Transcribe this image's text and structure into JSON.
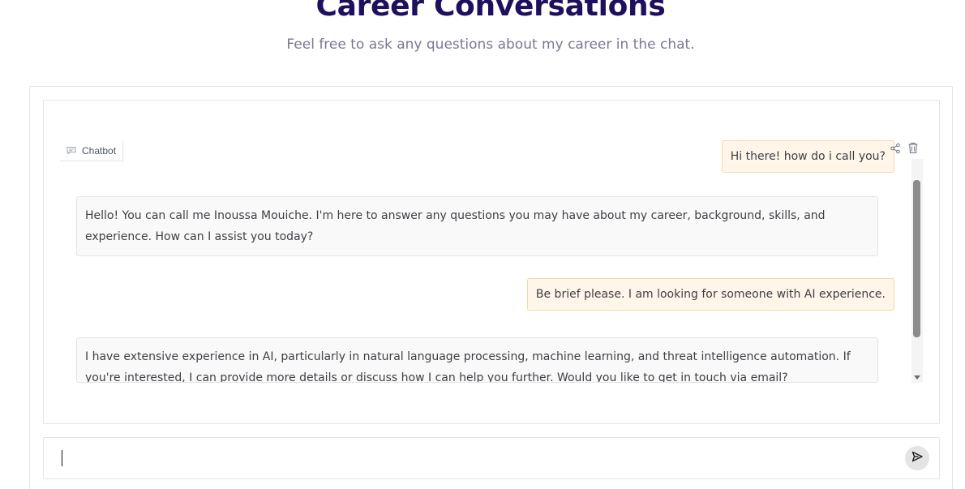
{
  "header": {
    "title": "Career Conversations",
    "subtitle": "Feel free to ask any questions about my career in the chat."
  },
  "chatbot": {
    "label": "Chatbot",
    "icon": "chat-bubble-icon",
    "messages": [
      {
        "role": "user",
        "text": "Hi there! how do i call you?"
      },
      {
        "role": "bot",
        "text": "Hello! You can call me Inoussa Mouiche. I'm here to answer any questions you may have about my career, background, skills, and experience. How can I assist you today?"
      },
      {
        "role": "user",
        "text": "Be brief please. I am looking for someone with AI experience."
      },
      {
        "role": "bot",
        "text": "I have extensive experience in AI, particularly in natural language processing, machine learning, and threat intelligence automation. If you're interested, I can provide more details or discuss how I can help you further. Would you like to get in touch via email?"
      }
    ],
    "actions": [
      "share-icon",
      "trash-icon"
    ]
  },
  "input": {
    "value": "",
    "placeholder": ""
  },
  "send": {
    "icon": "send-icon"
  },
  "colors": {
    "title": "#1f0f5c",
    "subtitle": "#7b7795",
    "user_bubble_bg": "#fff5e8",
    "user_bubble_border": "#f6d8a8",
    "bot_bubble_bg": "#f9f9f9"
  }
}
